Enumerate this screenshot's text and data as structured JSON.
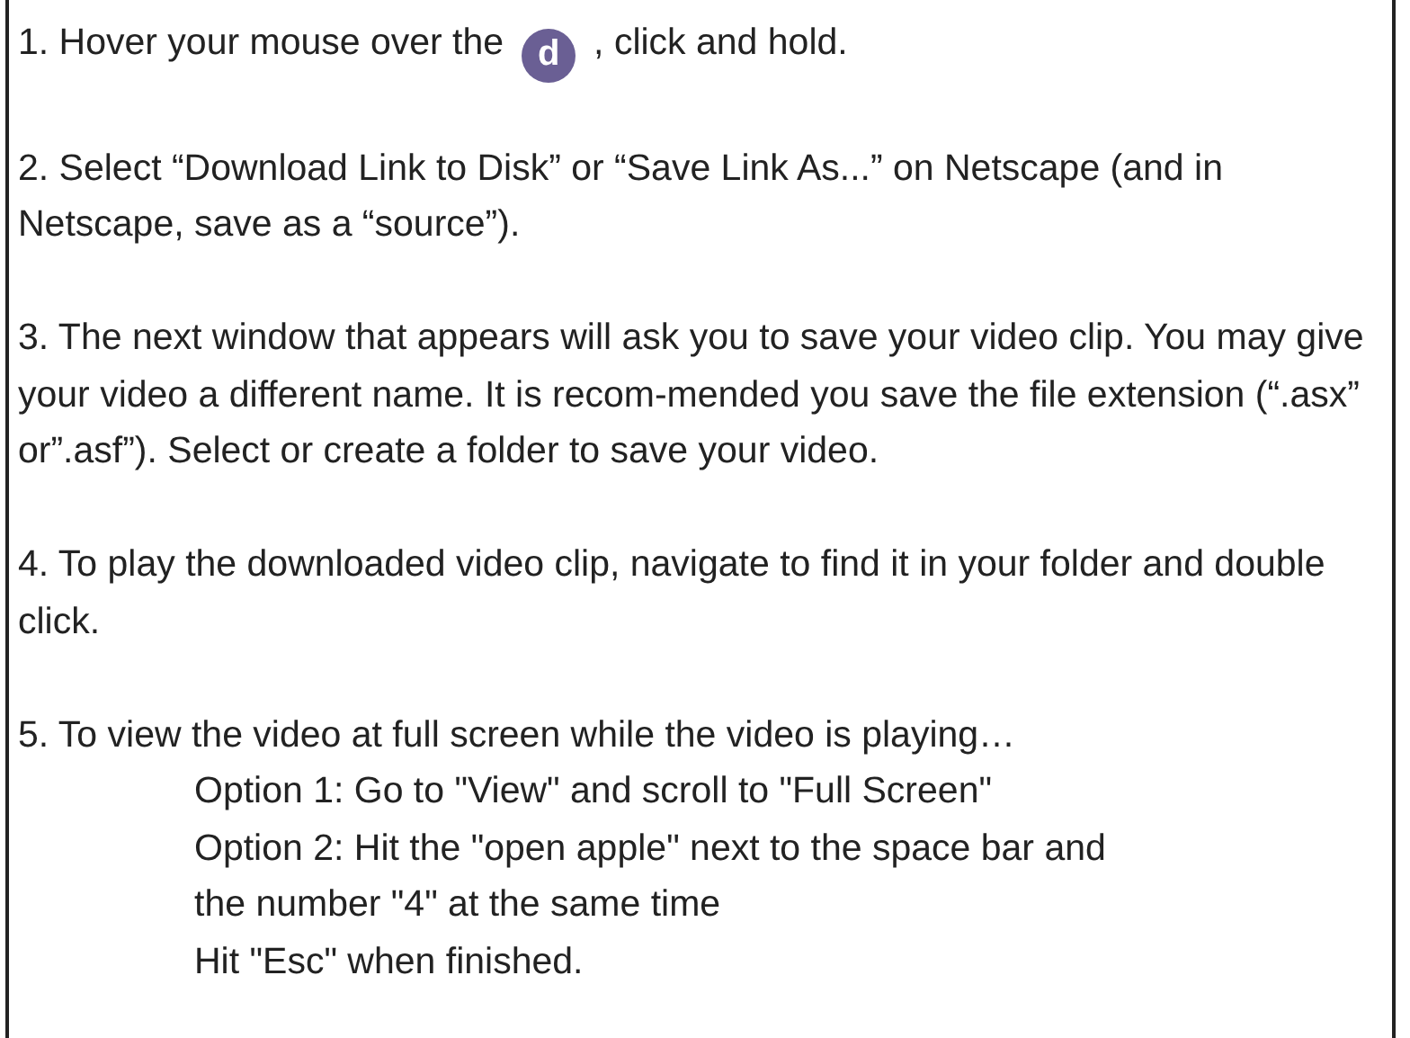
{
  "steps": [
    {
      "kind": "icon",
      "before": "1. Hover your mouse over the",
      "icon_letter": "d",
      "after": ", click and hold."
    },
    {
      "kind": "text",
      "text": "2. Select “Download Link to Disk” or “Save Link As...” on Netscape (and in Netscape, save as a “source”)."
    },
    {
      "kind": "text",
      "text": "3. The next window that appears will ask you to save your video clip. You may give your video a different name. It is recom-mended you save the file extension (“.asx” or”.asf”). Select or create a folder to save your video."
    },
    {
      "kind": "text",
      "text": "4. To play the downloaded video clip, navigate to find it in your folder and double click."
    },
    {
      "kind": "options",
      "text": "5. To view the video at full screen while the video is playing…",
      "options": [
        "Option 1: Go to \"View\" and scroll to \"Full Screen\"",
        "Option 2: Hit the \"open apple\" next to the space bar and the number \"4\" at the same time",
        "Hit \"Esc\" when finished."
      ]
    }
  ]
}
